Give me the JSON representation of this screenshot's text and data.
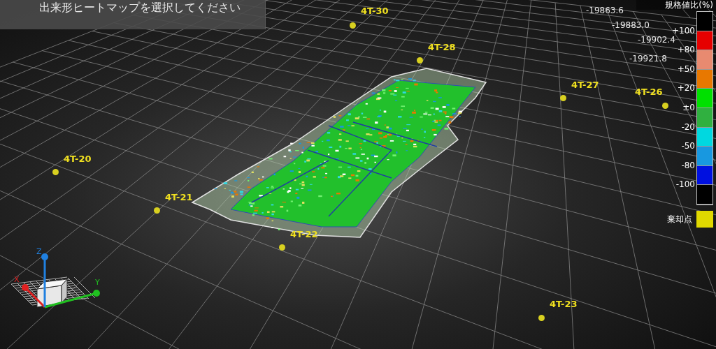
{
  "prompt": {
    "text": "出来形ヒートマップを選択してください"
  },
  "elevation_labels": [
    "-19863.6",
    "-19883.0",
    "-19902.4",
    "-19921.8"
  ],
  "points": [
    {
      "label": "4T-30"
    },
    {
      "label": "4T-28"
    },
    {
      "label": "4T-27"
    },
    {
      "label": "4T-26"
    },
    {
      "label": "4T-20"
    },
    {
      "label": "4T-21"
    },
    {
      "label": "4T-22"
    },
    {
      "label": "4T-23"
    }
  ],
  "legend": {
    "title": "規格値比(%)",
    "swatches": [
      {
        "color": "#000000"
      },
      {
        "color": "#e60000"
      },
      {
        "color": "#e88a70"
      },
      {
        "color": "#e87800"
      },
      {
        "color": "#00e000"
      },
      {
        "color": "#30b040"
      },
      {
        "color": "#00d8e0"
      },
      {
        "color": "#1898e0"
      },
      {
        "color": "#0010e0"
      },
      {
        "color": "#000000"
      }
    ],
    "ticks": [
      "+100",
      "+80",
      "+50",
      "+20",
      "±0",
      "-20",
      "-50",
      "-80",
      "-100"
    ],
    "reject": {
      "label": "棄却点",
      "color": "#e0d800"
    }
  },
  "gizmo": {
    "axes": [
      {
        "label": "X",
        "color": "#e02020"
      },
      {
        "label": "Y",
        "color": "#20c020"
      },
      {
        "label": "Z",
        "color": "#2080e0"
      }
    ]
  }
}
